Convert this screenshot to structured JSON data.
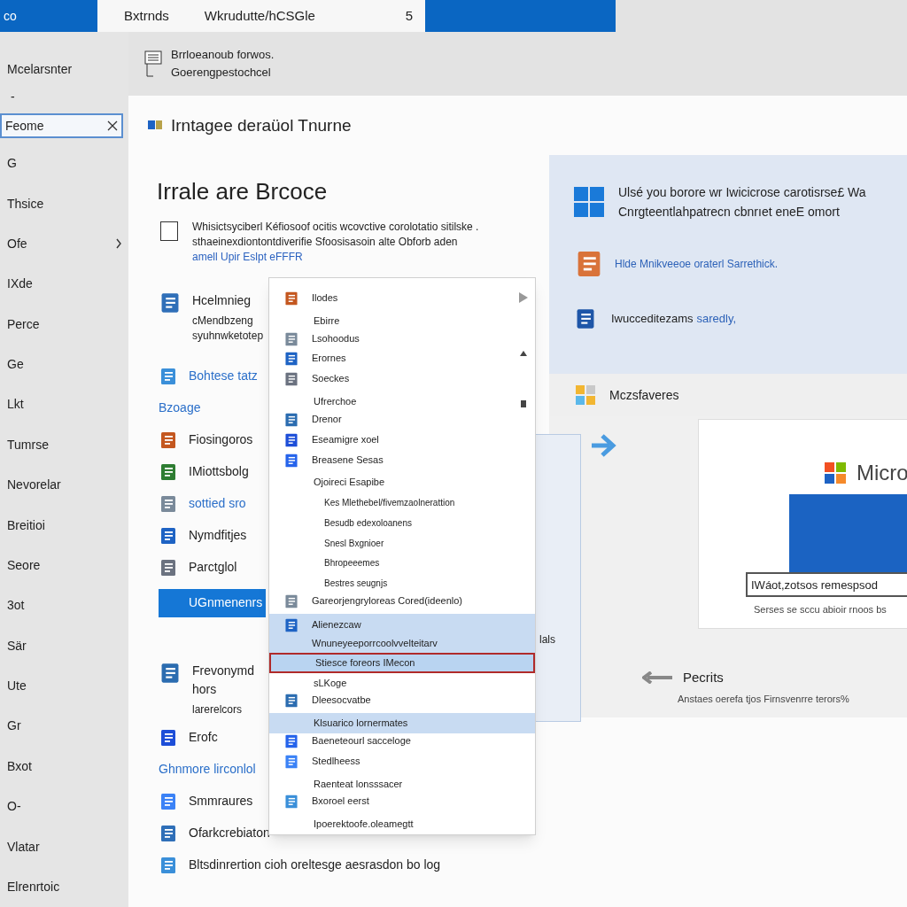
{
  "top_bar": {
    "app_label": "co",
    "tab": {
      "title": "Bxtrnds",
      "subtitle": "Wkrudutte/hCSGle",
      "badge": "5"
    }
  },
  "sidebar": {
    "title": "Mcelarsnter",
    "subtitle": "-",
    "search": {
      "value": "Feome"
    },
    "items": [
      {
        "label": "G",
        "submenu": false
      },
      {
        "label": "Thsice",
        "submenu": false
      },
      {
        "label": "Ofe",
        "submenu": true
      },
      {
        "label": "IXde",
        "submenu": false
      },
      {
        "label": "Perce",
        "submenu": false
      },
      {
        "label": "Ge",
        "submenu": false
      },
      {
        "label": "Lkt",
        "submenu": false
      },
      {
        "label": "Tumrse",
        "submenu": false
      },
      {
        "label": "Nevorelar",
        "submenu": false
      },
      {
        "label": "Breitioi",
        "submenu": false
      },
      {
        "label": "Seore",
        "submenu": false
      },
      {
        "label": "3ot",
        "submenu": false
      },
      {
        "label": "Sär",
        "submenu": false
      },
      {
        "label": "Ute",
        "submenu": false
      },
      {
        "label": "Gr",
        "submenu": false
      },
      {
        "label": "Bxot",
        "submenu": false
      },
      {
        "label": "O-",
        "submenu": false
      },
      {
        "label": "Vlatar",
        "submenu": false
      },
      {
        "label": "Elrenrtoic",
        "submenu": false
      }
    ]
  },
  "header": {
    "lines": [
      "Brrloeanoub forwos.",
      "Goerengpestochcel"
    ]
  },
  "main": {
    "title": "Irntagee deraüol Tnurne",
    "heading": "Irrale are Brcoce",
    "notice": {
      "checked": false,
      "text": "Whisictsyciberl Kéfiosoof ocitis wcovctive corolotatio sitilske . sthaeinexdiontontdiverifie Sfoosisasoin alte Obforb aden",
      "link": "amell Upir Eslpt eFFFR"
    },
    "list": [
      {
        "kind": "note",
        "label": "Hcelmnieg",
        "detail": "cMendbzeng syuhnwketotep"
      },
      {
        "kind": "icon_link",
        "label": "Bohtese tatz"
      },
      {
        "kind": "link",
        "label": "Bzoage"
      },
      {
        "kind": "item",
        "label": "Fiosingoros"
      },
      {
        "kind": "item",
        "label": "IMiottsbolg"
      },
      {
        "kind": "icon_link",
        "label": "sottied sro"
      },
      {
        "kind": "item",
        "label": "Nymdfitjes"
      },
      {
        "kind": "item",
        "label": "Parctglol"
      },
      {
        "kind": "button",
        "label": "UGnmenenrs"
      },
      {
        "kind": "note",
        "label": "Frevonymd hors",
        "detail": "larerelcors"
      },
      {
        "kind": "item",
        "label": "Erofc"
      },
      {
        "kind": "link",
        "label": "Ghnmore lirconlol"
      },
      {
        "kind": "item",
        "label": "Smmraures"
      },
      {
        "kind": "item",
        "label": "Ofarkcrebiaton"
      },
      {
        "kind": "item",
        "label": "Bltsdinrertion cioh oreltesge aesrasdon bo log"
      }
    ]
  },
  "dropdown": {
    "items": [
      {
        "kind": "icon",
        "label": "Ilodes",
        "highlighted": false,
        "selected": false
      },
      {
        "kind": "plain",
        "label": "Ebirre",
        "highlighted": false,
        "selected": false
      },
      {
        "kind": "icon",
        "label": "Lsohoodus",
        "highlighted": false,
        "selected": false
      },
      {
        "kind": "icon",
        "label": "Erornes",
        "highlighted": false,
        "selected": false
      },
      {
        "kind": "icon",
        "label": "Soeckes",
        "highlighted": false,
        "selected": false
      },
      {
        "kind": "plain",
        "label": "Ufrerchoe",
        "highlighted": false,
        "selected": false
      },
      {
        "kind": "icon",
        "label": "Drenor",
        "highlighted": false,
        "selected": false
      },
      {
        "kind": "icon",
        "label": "Eseamigre xoel",
        "highlighted": false,
        "selected": false
      },
      {
        "kind": "icon",
        "label": "Breasene Sesas",
        "highlighted": false,
        "selected": false
      },
      {
        "kind": "plain",
        "label": "Ojoireci Esapibe",
        "highlighted": false,
        "selected": false
      },
      {
        "kind": "indent",
        "label": "Kes",
        "detail": "Mlethebel/fivemzaolnerattion",
        "highlighted": false,
        "selected": false
      },
      {
        "kind": "indent",
        "label": "Besudb edexoloanens",
        "highlighted": false,
        "selected": false
      },
      {
        "kind": "indent",
        "label": "Snesl Bxgnioer",
        "highlighted": false,
        "selected": false
      },
      {
        "kind": "indent",
        "label": "Bhropeeemes",
        "highlighted": false,
        "selected": false
      },
      {
        "kind": "indent",
        "label": "Bestres seugnjs",
        "highlighted": false,
        "selected": false
      },
      {
        "kind": "icon",
        "label": "Gareorjengryloreas Cored(ideenlo)",
        "highlighted": false,
        "selected": false
      },
      {
        "kind": "icon",
        "label": "Alienezcaw",
        "detail": "Wnuneyeeporrcoolvvelteitarv",
        "highlighted": true,
        "selected": false
      },
      {
        "kind": "plain",
        "label": "Stiesce foreors IMecon",
        "highlighted": false,
        "selected": true
      },
      {
        "kind": "plain",
        "label": "sLKoge",
        "highlighted": false,
        "selected": false
      },
      {
        "kind": "icon",
        "label": "Dleesocvatbe",
        "highlighted": false,
        "selected": false
      },
      {
        "kind": "plain",
        "label": "Klsuarico lornermates",
        "highlighted": true,
        "selected": false
      },
      {
        "kind": "icon",
        "label": "Baeneteourl sacceloge",
        "highlighted": false,
        "selected": false
      },
      {
        "kind": "icon",
        "label": "Stedlheess",
        "highlighted": false,
        "selected": false
      },
      {
        "kind": "plain",
        "label": "Raenteat lonsssacer",
        "highlighted": false,
        "selected": false
      },
      {
        "kind": "icon",
        "label": "Bxoroel eerst",
        "highlighted": false,
        "selected": false
      },
      {
        "kind": "plain",
        "label": "Ipoerektoofe.oleamegtt",
        "highlighted": false,
        "selected": false
      }
    ]
  },
  "back_panel": {
    "text": "lals"
  },
  "promo": {
    "items": [
      {
        "kind": "logo",
        "lines": [
          "Ulsé you borore wr Iwicicrose carotisrse£ Wa",
          "Cnrgteentlahpatrecn cbnrıet eneE omort"
        ]
      },
      {
        "kind": "link",
        "text": "Hlde Mnikveeoe oraterl Sarrethick."
      },
      {
        "kind": "mixed",
        "text": "Iwucceditezams",
        "link": "saredly,"
      }
    ],
    "footer": "Mczsfaveres"
  },
  "card": {
    "brand": "Micro",
    "input": {
      "value": "IWáot,zotsos remespsod"
    },
    "caption": "Serses se sccu abioir rnoos bs"
  },
  "back": {
    "label": "Pecrits",
    "caption": "Anstaes oerefa tjos Firnsvenrre terors%"
  }
}
